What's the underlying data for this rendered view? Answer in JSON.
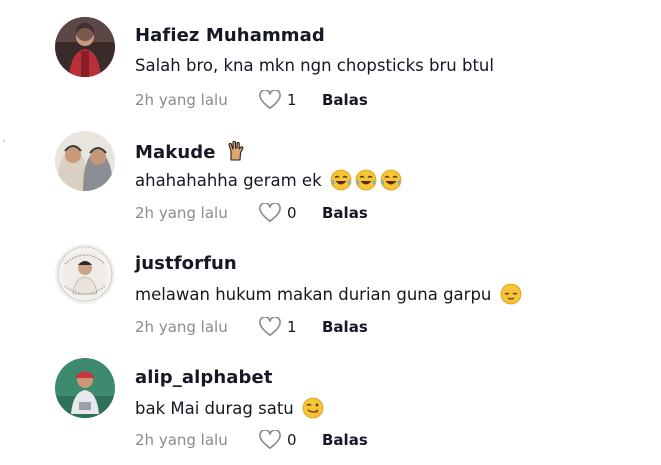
{
  "comments": [
    {
      "username": "Hafiez  Muhammad",
      "text": "Salah bro, kna mkn ngn chopsticks bru btul",
      "time": "2h yang lalu",
      "likes": "1",
      "reply": "Balas",
      "emoji": []
    },
    {
      "username": "Makude",
      "username_emoji": "hand-sign-emoji",
      "text": "ahahahahha geram ek",
      "time": "2h yang lalu",
      "likes": "0",
      "reply": "Balas",
      "emoji": [
        "tears-of-joy-emoji",
        "tears-of-joy-emoji",
        "tears-of-joy-emoji"
      ]
    },
    {
      "username": "justforfun",
      "text": "melawan hukum makan durian guna garpu",
      "time": "2h yang lalu",
      "likes": "1",
      "reply": "Balas",
      "emoji": [
        "relieved-face-emoji"
      ]
    },
    {
      "username": "alip_alphabet",
      "text": "bak Mai durag satu",
      "time": "2h yang lalu",
      "likes": "0",
      "reply": "Balas",
      "emoji": [
        "yum-face-emoji"
      ]
    }
  ],
  "icons": {
    "like": "heart-outline-icon"
  },
  "colors": {
    "username": "#161823",
    "meta": "#8a8b91",
    "heart_stroke": "#8a8b91",
    "emoji_yellow": "#f7c436"
  }
}
